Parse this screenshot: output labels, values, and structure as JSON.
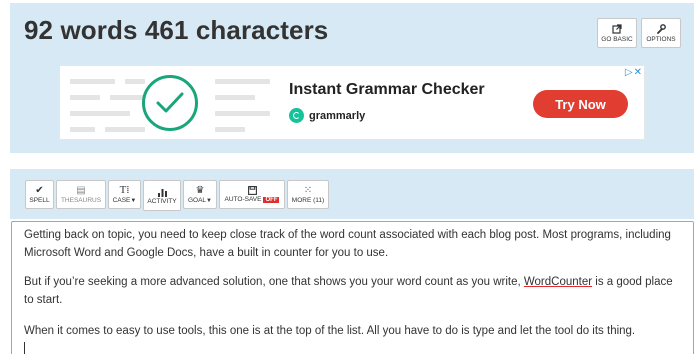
{
  "header": {
    "title": "92 words 461 characters",
    "go_basic_label": "GO BASIC",
    "options_label": "OPTIONS"
  },
  "ad": {
    "headline": "Instant Grammar Checker",
    "brand": "grammarly",
    "cta": "Try Now",
    "brand_color": "#15c39a",
    "cta_color": "#e23d31"
  },
  "toolbar": {
    "spell": "SPELL",
    "thesaurus": "THESAURUS",
    "case": "CASE",
    "activity": "ACTIVITY",
    "goal": "GOAL",
    "autosave": "AUTO-SAVE",
    "autosave_state": "OFF",
    "more": "MORE (11)"
  },
  "editor": {
    "paragraph_1": "Getting back on topic, you need to keep close track of the word count associated with each blog post. Most programs, including Microsoft Word and Google Docs, have a built in counter for you to use.",
    "paragraph_2_before": "But if you’re seeking a more advanced solution, one that shows you your word count as you write, ",
    "paragraph_2_link": "WordCounter",
    "paragraph_2_after": " is a good place to start.",
    "paragraph_3": "When it comes to easy to use tools, this one is at the top of the list. All you have to do is type and let the tool do its thing."
  },
  "colors": {
    "panel_bg": "#d6e9f5",
    "editor_border": "#7fb0d9"
  }
}
